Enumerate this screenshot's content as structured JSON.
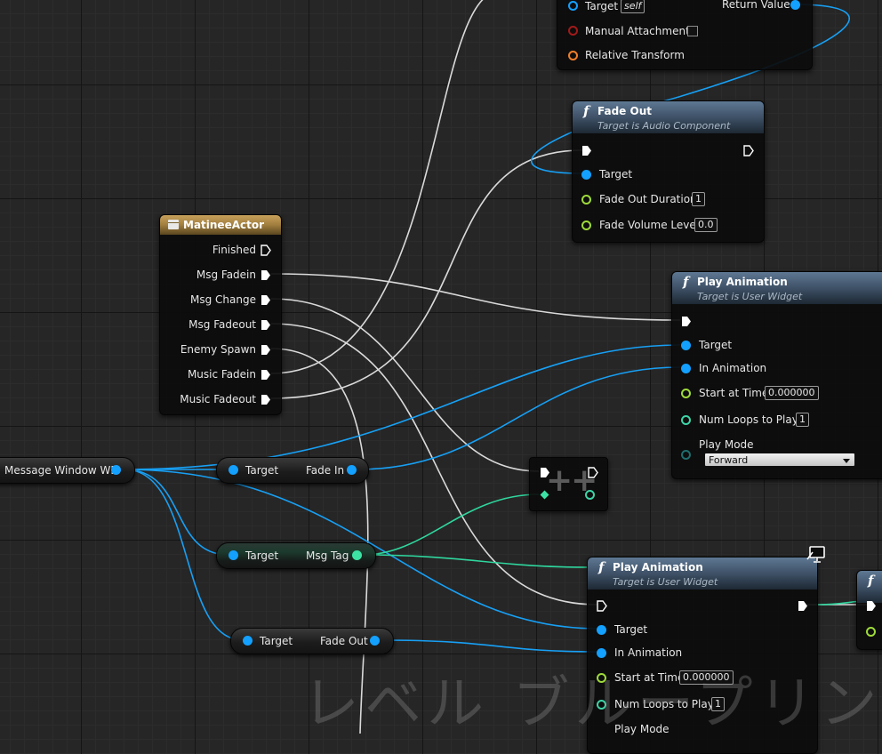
{
  "watermark": "レベル ブループリント",
  "top_node": {
    "target_label": "Target",
    "target_value": "self",
    "manual_attachment_label": "Manual Attachment",
    "relative_transform_label": "Relative Transform",
    "return_value_label": "Return Value"
  },
  "fade_out_node": {
    "title": "Fade Out",
    "subtitle": "Target is Audio Component",
    "target_label": "Target",
    "duration_label": "Fade Out Duration",
    "duration_value": "1",
    "volume_label": "Fade Volume Level",
    "volume_value": "0.0"
  },
  "matinee_node": {
    "title": "MatineeActor",
    "outputs": [
      "Finished",
      "Msg Fadein",
      "Msg Change",
      "Msg Fadeout",
      "Enemy Spawn",
      "Music Fadein",
      "Music Fadeout"
    ]
  },
  "play_anim_1": {
    "title": "Play Animation",
    "subtitle": "Target is User Widget",
    "target_label": "Target",
    "in_animation_label": "In Animation",
    "start_time_label": "Start at Time",
    "start_time_value": "0.000000",
    "num_loops_label": "Num Loops to Play",
    "num_loops_value": "1",
    "play_mode_label": "Play Mode",
    "play_mode_value": "Forward"
  },
  "play_anim_2": {
    "title": "Play Animation",
    "subtitle": "Target is User Widget",
    "target_label": "Target",
    "in_animation_label": "In Animation",
    "start_time_label": "Start at Time",
    "start_time_value": "0.000000",
    "num_loops_label": "Num Loops to Play",
    "num_loops_value": "1",
    "play_mode_label": "Play Mode"
  },
  "message_window_var": {
    "label": "Message Window WB"
  },
  "getters": {
    "fade_in": {
      "target_label": "Target",
      "output_label": "Fade In"
    },
    "msg_tag": {
      "target_label": "Target",
      "output_label": "Msg Tag"
    },
    "fade_out": {
      "target_label": "Target",
      "output_label": "Fade Out"
    }
  },
  "increment_node": {
    "symbol": "++"
  },
  "colors": {
    "exec_wire": "#d8d8d8",
    "object_pin": "#13a0ff",
    "float_pin": "#9edb3a",
    "int_pin": "#3ed4a7",
    "struct_pin": "#f07e2a",
    "bool_pin": "#a11a1a",
    "function_header": "#4a6078",
    "variable_header": "#b08c48"
  },
  "icons": [
    "function-icon",
    "variable-icon",
    "exec-pin-icon",
    "dropdown-arrow-icon",
    "monitor-icon"
  ]
}
